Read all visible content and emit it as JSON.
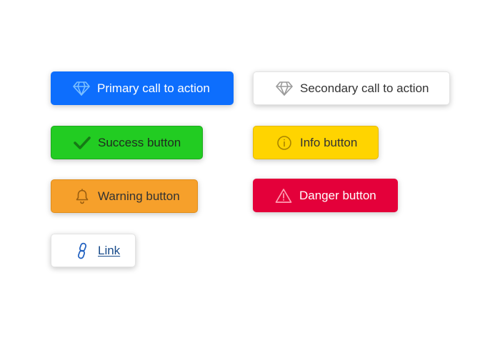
{
  "buttons": {
    "primary": {
      "label": "Primary call to action",
      "icon": "diamond-icon",
      "color": "#0d6efd"
    },
    "secondary": {
      "label": "Secondary call to action",
      "icon": "diamond-icon",
      "color": "#ffffff"
    },
    "success": {
      "label": "Success button",
      "icon": "checkmark-icon",
      "color": "#22cc22"
    },
    "info": {
      "label": "Info button",
      "icon": "info-circle-icon",
      "color": "#ffd400"
    },
    "warning": {
      "label": "Warning button",
      "icon": "bell-icon",
      "color": "#f6a02b"
    },
    "danger": {
      "label": "Danger button",
      "icon": "warning-triangle-icon",
      "color": "#e4003a"
    },
    "link": {
      "label": "Link",
      "icon": "link-icon",
      "color": "#174a8a"
    }
  }
}
